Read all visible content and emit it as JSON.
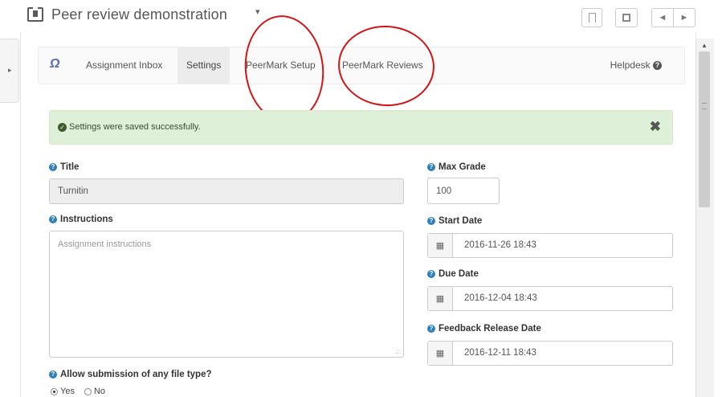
{
  "header": {
    "title": "Peer review demonstration",
    "caret": "▾",
    "bookmark_icon": "bookmark-icon",
    "popout_icon": "popout-icon",
    "prev_icon": "◄",
    "next_icon": "►"
  },
  "tool_nav": {
    "logo_icon": "turnitin-logo-icon",
    "logo_glyph": "Ω",
    "items": [
      {
        "label": "Assignment Inbox"
      },
      {
        "label": "Settings",
        "active": true
      },
      {
        "label": "PeerMark Setup",
        "highlighted": true
      },
      {
        "label": "PeerMark Reviews",
        "highlighted": true
      }
    ],
    "helpdesk_label": "Helpdesk",
    "helpdesk_icon": "?"
  },
  "alert": {
    "message": "Settings were saved successfully.",
    "check_icon": "✓",
    "close_icon": "✖",
    "color": "#dff0d8"
  },
  "form": {
    "title_label": "Title",
    "title_value": "Turnitin",
    "instructions_label": "Instructions",
    "instructions_placeholder": "Assignment instructions",
    "max_grade_label": "Max Grade",
    "max_grade_value": "100",
    "start_date_label": "Start Date",
    "start_date_value": "2016-11-26 18:43",
    "due_date_label": "Due Date",
    "due_date_value": "2016-12-04 18:43",
    "feedback_date_label": "Feedback Release Date",
    "feedback_date_value": "2016-12-11 18:43",
    "file_type_label": "Allow submission of any file type?",
    "radio_yes": "Yes",
    "radio_no": "No",
    "help_icon": "?",
    "calendar_icon": "▦"
  },
  "colors": {
    "annotation": "#d31515",
    "help_icon": "#2f7fbf"
  }
}
